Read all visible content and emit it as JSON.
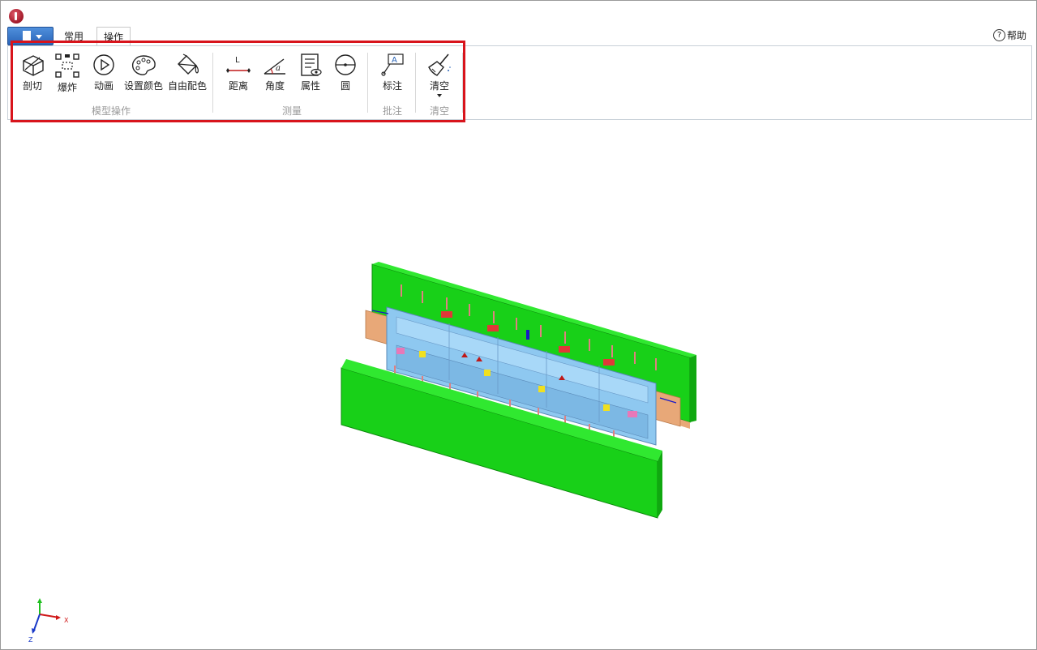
{
  "tabs": {
    "common": "常用",
    "operations": "操作"
  },
  "help": {
    "label": "帮助",
    "icon": "question-circle-icon"
  },
  "ribbon": {
    "groups": [
      {
        "label": "模型操作",
        "tools": [
          "剖切",
          "爆炸",
          "动画",
          "设置颜色",
          "自由配色"
        ]
      },
      {
        "label": "测量",
        "tools": [
          "距离",
          "角度",
          "属性",
          "圆"
        ]
      },
      {
        "label": "批注",
        "tools": [
          "标注"
        ]
      },
      {
        "label": "清空",
        "tools": [
          "清空"
        ]
      }
    ]
  },
  "axes": {
    "x": "X",
    "z": "Z"
  },
  "colors": {
    "highlight": "#d8141c",
    "plate": "#18d018",
    "core": "#8ec8f0",
    "side": "#e8a878"
  }
}
